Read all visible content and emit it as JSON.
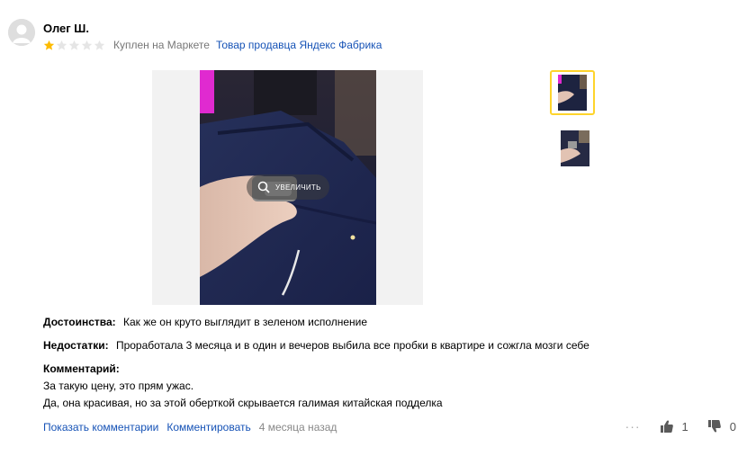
{
  "review": {
    "author": "Олег Ш.",
    "rating": 1,
    "rating_max": 5,
    "purchase_note": "Куплен на Маркете",
    "seller_link": "Товар продавца Яндекс Фабрика",
    "zoom_label": "УВЕЛИЧИТЬ",
    "pros_label": "Достоинства:",
    "pros_text": "Как же он круто выглядит в зеленом исполнение",
    "cons_label": "Недостатки:",
    "cons_text": "Проработала 3 месяца и в один и вечеров выбила все пробки в квартире и сожгла мозги себе",
    "comment_label": "Комментарий:",
    "comment_lines": [
      "За такую цену, это прям ужас.",
      "Да, она красивая, но за этой оберткой скрывается галимая китайская подделка"
    ],
    "show_comments": "Показать комментарии",
    "comment_action": "Комментировать",
    "date": "4 месяца назад",
    "more_icon": "···",
    "likes": "1",
    "dislikes": "0"
  },
  "colors": {
    "link": "#1552b6",
    "star_filled": "#fdbb00",
    "star_empty": "#e5e5e5",
    "thumb_selected_border": "#fed42b"
  },
  "icons": {
    "avatar": "user-avatar-icon",
    "zoom": "magnifier-icon",
    "like": "thumbs-up-icon",
    "dislike": "thumbs-down-icon",
    "more": "more-dots-icon"
  }
}
